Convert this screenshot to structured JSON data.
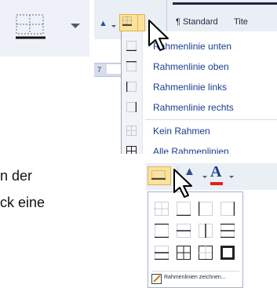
{
  "ribbon": {
    "style_standard": "¶ Standard",
    "style_next": "Tite",
    "ruler_number": "7"
  },
  "border_menu": {
    "items": [
      {
        "label": "Rahmenlinie unten",
        "icon": "border-bottom-icon"
      },
      {
        "label": "Rahmenlinie oben",
        "icon": "border-top-icon"
      },
      {
        "label": "Rahmenlinie links",
        "icon": "border-left-icon"
      },
      {
        "label": "Rahmenlinie rechts",
        "icon": "border-right-icon"
      },
      {
        "label": "Kein Rahmen",
        "icon": "no-border-icon"
      },
      {
        "label": "Alle Rahmenlinien",
        "icon": "all-borders-icon"
      }
    ]
  },
  "body_text": {
    "line1": "n der",
    "line2": "ck eine"
  },
  "border_panel": {
    "draw_label": "Rahmenlinien zeichnen...",
    "font_color": "#e02020",
    "font_letter": "A"
  },
  "colors": {
    "highlight": "#fbe29a",
    "ribbon_bg": "#eaeef5",
    "menu_text": "#1a3d8f"
  }
}
